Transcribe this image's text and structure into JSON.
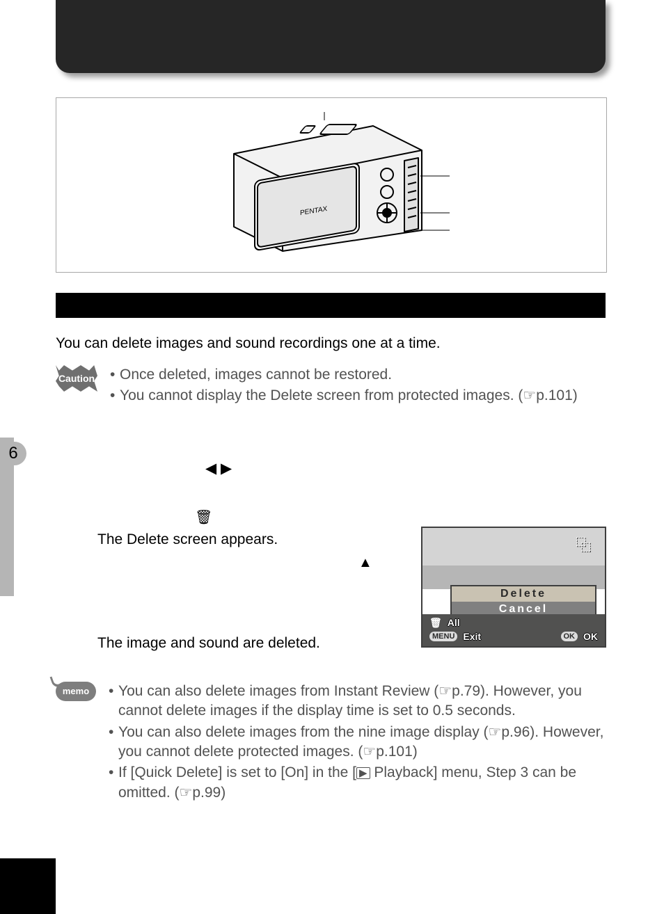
{
  "sidebar": {
    "chapter": "6"
  },
  "intro": "You can delete images and sound recordings one at a time.",
  "caution": {
    "label": "Caution",
    "items": [
      {
        "text": "Once deleted, images cannot be restored."
      },
      {
        "text": "You cannot display the Delete screen from protected images. (",
        "ref": "p.101",
        "tail": ")"
      }
    ]
  },
  "steps": {
    "s2_result": "The Delete screen appears.",
    "s4_result": "The image and sound are deleted."
  },
  "screen": {
    "delete": "Delete",
    "cancel": "Cancel",
    "all": "All",
    "menu": "MENU",
    "exit": "Exit",
    "ok_pill": "OK",
    "ok": "OK"
  },
  "memo": {
    "label": "memo",
    "items": [
      {
        "pre": "You can also delete images from Instant Review (",
        "ref": "p.79",
        "post": "). However, you cannot delete images if the display time is set to 0.5 seconds."
      },
      {
        "pre": "You can also delete images from the nine image display (",
        "ref": "p.96",
        "mid": "). However, you cannot delete protected images. (",
        "ref2": "p.101",
        "post": ")"
      },
      {
        "pre": "If [Quick Delete] is set to [On] in the [",
        "play": "▶",
        "mid": " Playback] menu, Step 3 can be omitted. (",
        "ref": "p.99",
        "post": ")"
      }
    ]
  }
}
